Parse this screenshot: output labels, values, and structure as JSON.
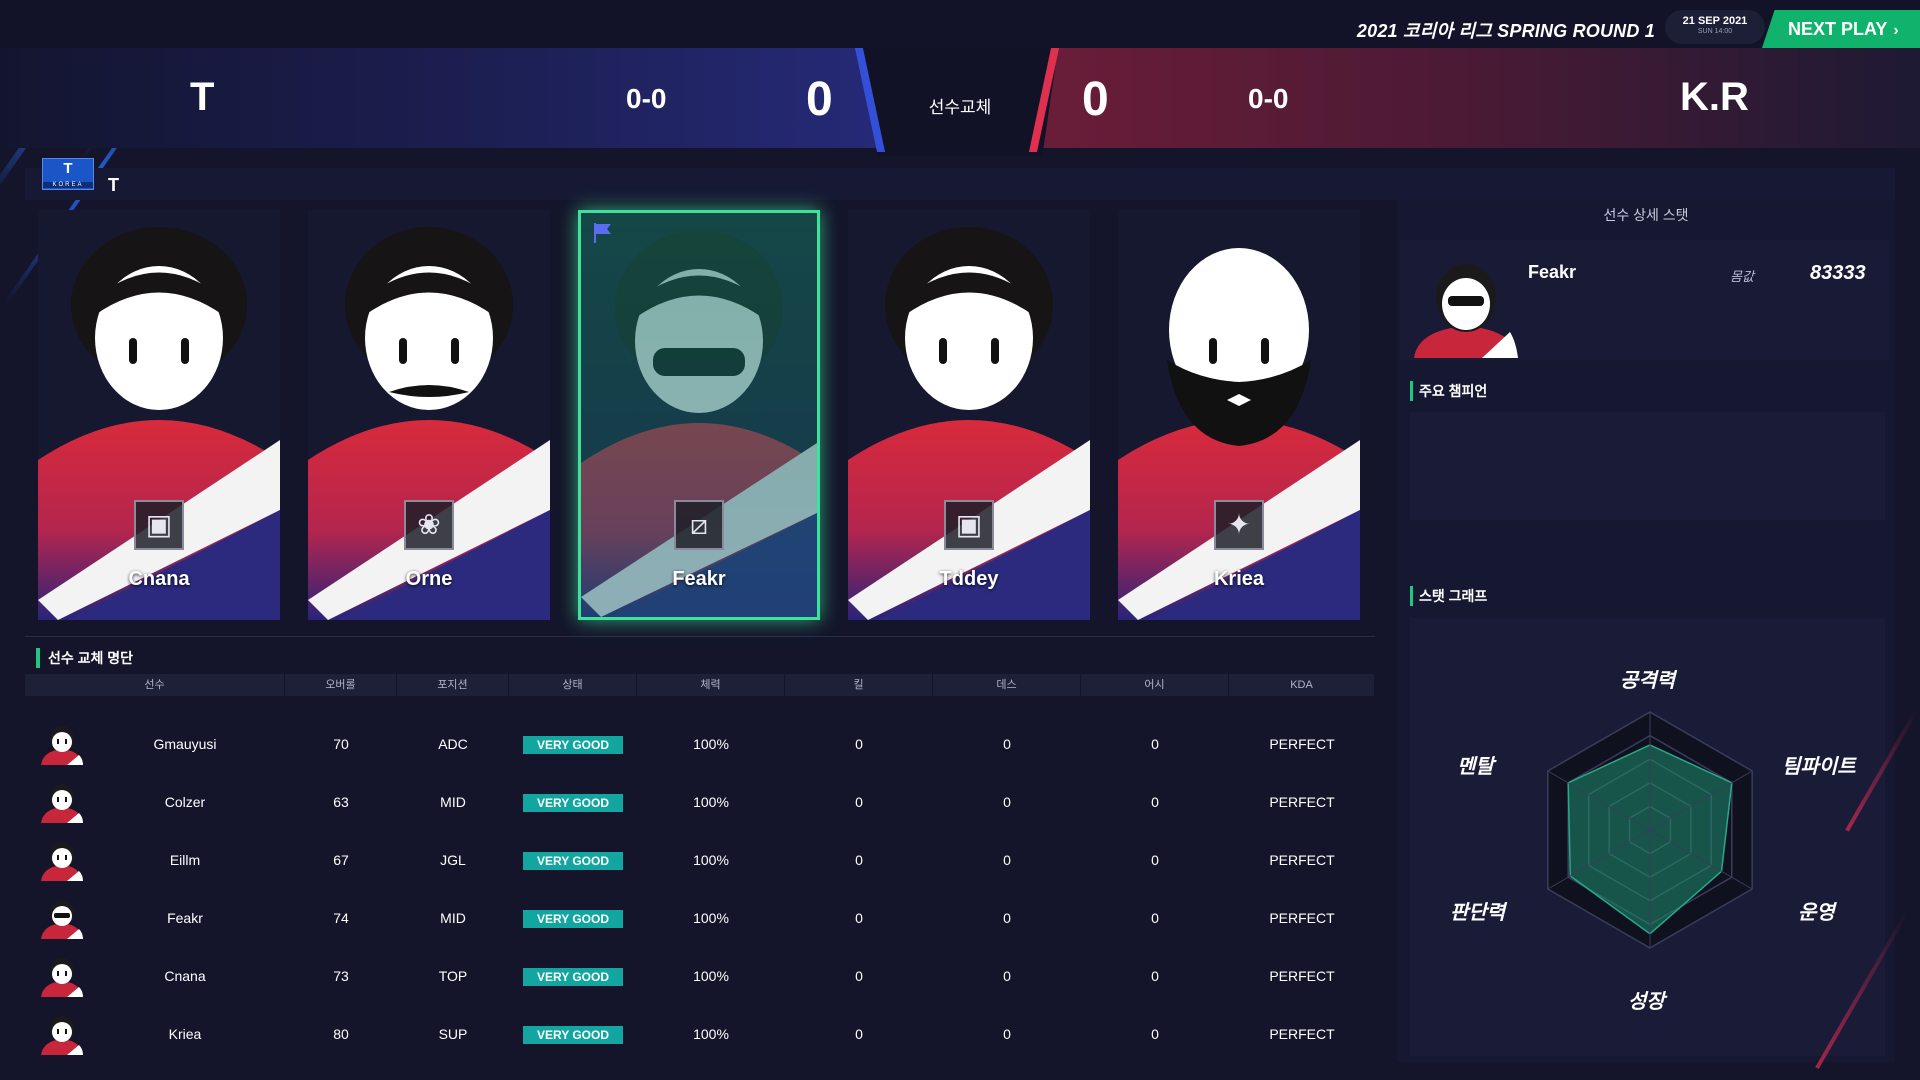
{
  "header": {
    "league_title": "2021 코리아 리그 SPRING ROUND 1",
    "date_main": "21 SEP 2021",
    "date_sub": "SUN 14:00",
    "next_play_label": "NEXT PLAY",
    "next_play_icon": "chevron-right-icon"
  },
  "scoreboard": {
    "left_team": "T",
    "left_record": "0-0",
    "left_score": "0",
    "center_label": "선수교체",
    "right_score": "0",
    "right_record": "0-0",
    "right_team": "K.R",
    "colors": {
      "left": "#262a78",
      "right": "#6b1d38",
      "accent_blue": "#3450d8",
      "accent_red": "#e03050"
    }
  },
  "team_bar": {
    "logo_letter": "T",
    "logo_sub": "KOREA",
    "team_name": "T"
  },
  "lineup": [
    {
      "name": "Cnana",
      "icon": "top-lane-icon",
      "selected": false
    },
    {
      "name": "Orne",
      "icon": "jungle-lane-icon",
      "selected": false
    },
    {
      "name": "Feakr",
      "icon": "mid-lane-icon",
      "selected": true
    },
    {
      "name": "Tddey",
      "icon": "bot-lane-icon",
      "selected": false
    },
    {
      "name": "Kriea",
      "icon": "support-lane-icon",
      "selected": false
    }
  ],
  "roster": {
    "title": "선수 교체 명단",
    "columns": [
      "선수",
      "오버롤",
      "포지션",
      "상태",
      "체력",
      "킬",
      "데스",
      "어시",
      "KDA"
    ],
    "rows": [
      {
        "name": "Gmauyusi",
        "overall": "70",
        "position": "ADC",
        "status": "VERY GOOD",
        "stamina": "100%",
        "kills": "0",
        "deaths": "0",
        "assists": "0",
        "kda": "PERFECT"
      },
      {
        "name": "Colzer",
        "overall": "63",
        "position": "MID",
        "status": "VERY GOOD",
        "stamina": "100%",
        "kills": "0",
        "deaths": "0",
        "assists": "0",
        "kda": "PERFECT"
      },
      {
        "name": "Eillm",
        "overall": "67",
        "position": "JGL",
        "status": "VERY GOOD",
        "stamina": "100%",
        "kills": "0",
        "deaths": "0",
        "assists": "0",
        "kda": "PERFECT"
      },
      {
        "name": "Feakr",
        "overall": "74",
        "position": "MID",
        "status": "VERY GOOD",
        "stamina": "100%",
        "kills": "0",
        "deaths": "0",
        "assists": "0",
        "kda": "PERFECT"
      },
      {
        "name": "Cnana",
        "overall": "73",
        "position": "TOP",
        "status": "VERY GOOD",
        "stamina": "100%",
        "kills": "0",
        "deaths": "0",
        "assists": "0",
        "kda": "PERFECT"
      },
      {
        "name": "Kriea",
        "overall": "80",
        "position": "SUP",
        "status": "VERY GOOD",
        "stamina": "100%",
        "kills": "0",
        "deaths": "0",
        "assists": "0",
        "kda": "PERFECT"
      }
    ]
  },
  "detail": {
    "title": "선수 상세 스탯",
    "player_name": "Feakr",
    "value_label": "몸값",
    "value": "83333",
    "champions_title": "주요 챔피언",
    "graph_title": "스탯 그래프",
    "radar_axes": [
      "공격력",
      "팀파이트",
      "운영",
      "성장",
      "판단력",
      "멘탈"
    ],
    "radar_values": [
      0.72,
      0.8,
      0.7,
      0.88,
      0.78,
      0.8
    ]
  }
}
